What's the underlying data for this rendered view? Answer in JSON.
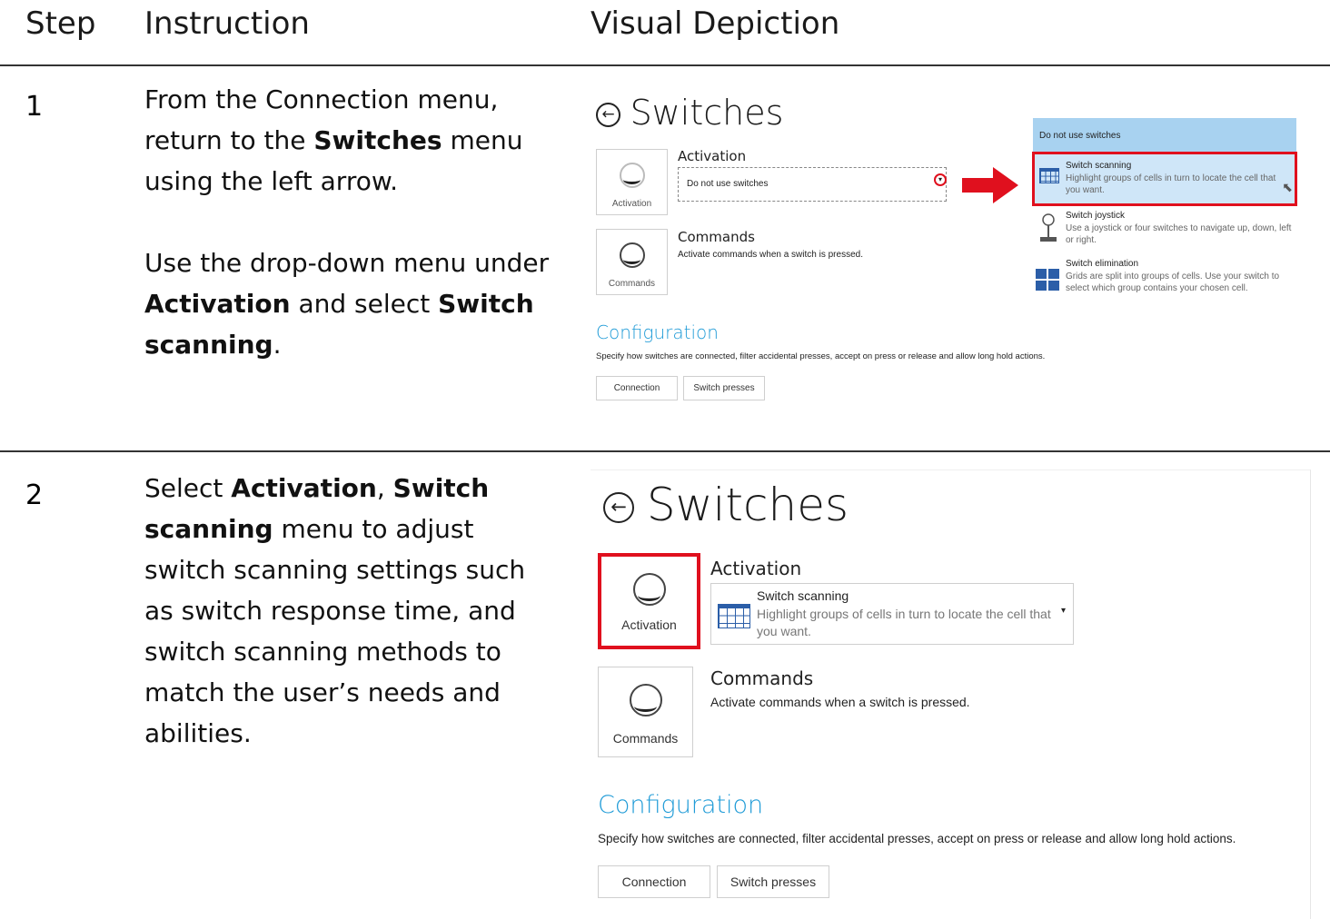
{
  "headers": {
    "step": "Step",
    "instruction": "Instruction",
    "visual": "Visual Depiction"
  },
  "steps": [
    {
      "number": "1",
      "p1": {
        "a": "From the Connection menu, return to the ",
        "b": "Switches",
        "c": " menu using the left arrow."
      },
      "p2": {
        "a": "Use the drop-down menu under ",
        "b1": "Activation",
        "c": " and select ",
        "b2": "Switch scanning",
        "d": "."
      }
    },
    {
      "number": "2",
      "p1": {
        "a": "Select ",
        "b1": "Activation",
        "c": ", ",
        "b2": "Switch scanning",
        "d": " menu to adjust switch scanning settings such as switch response time, and switch scanning methods to match the user’s needs and abilities."
      }
    }
  ],
  "shot1": {
    "title": "Switches",
    "activation_heading": "Activation",
    "activation_tile_label": "Activation",
    "dropdown_value": "Do not use switches",
    "commands_heading": "Commands",
    "commands_desc": "Activate commands when a switch is pressed.",
    "commands_tile_label": "Commands",
    "config_heading": "Configuration",
    "config_desc": "Specify how switches are connected, filter accidental presses, accept on press or release and allow long hold actions.",
    "buttons": [
      "Connection",
      "Switch presses"
    ],
    "menu": {
      "top_option": "Do not use switches",
      "options": [
        {
          "title": "Switch scanning",
          "desc": "Highlight groups of cells in turn to locate the cell that you want.",
          "icon": "grid-icon"
        },
        {
          "title": "Switch joystick",
          "desc": "Use a joystick or four switches to navigate up, down, left or right.",
          "icon": "joystick-icon"
        },
        {
          "title": "Switch elimination",
          "desc": "Grids are split into groups of cells. Use your switch to select which group contains your chosen cell.",
          "icon": "quad-grid-icon"
        }
      ]
    }
  },
  "shot2": {
    "title": "Switches",
    "activation_heading": "Activation",
    "activation_tile_label": "Activation",
    "dropdown_title": "Switch scanning",
    "dropdown_desc": "Highlight groups of cells in turn to locate the cell that you want.",
    "commands_heading": "Commands",
    "commands_desc": "Activate commands when a switch is pressed.",
    "commands_tile_label": "Commands",
    "config_heading": "Configuration",
    "config_desc": "Specify how switches are connected, filter accidental presses, accept on press or release and allow long hold actions.",
    "buttons": [
      "Connection",
      "Switch presses"
    ]
  },
  "colors": {
    "highlight": "#e0101e",
    "accent": "#1f9bd7",
    "menu_bg": "#a8d2f0",
    "menu_selected": "#cfe6f8"
  }
}
